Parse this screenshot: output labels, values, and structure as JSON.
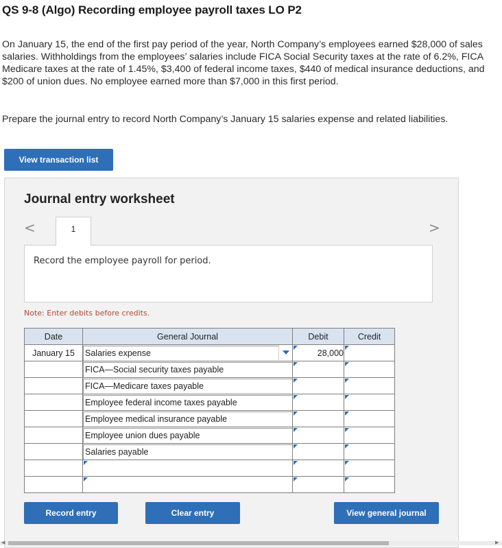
{
  "question": {
    "title": "QS 9-8 (Algo) Recording employee payroll taxes LO P2",
    "problem": "On January 15, the end of the first pay period of the year, North Company’s employees earned $28,000 of sales salaries. Withholdings from the employees’ salaries include FICA Social Security taxes at the rate of 6.2%, FICA Medicare taxes at the rate of 1.45%, $3,400 of federal income taxes, $440 of medical insurance deductions, and $200 of union dues. No employee earned more than $7,000 in this first period.",
    "instruction": "Prepare the journal entry to record North Company’s January 15 salaries expense and related liabilities."
  },
  "buttons": {
    "view_transactions": "View transaction list",
    "record_entry": "Record entry",
    "clear_entry": "Clear entry",
    "view_journal": "View general journal"
  },
  "worksheet": {
    "title": "Journal entry worksheet",
    "tab_number": "1",
    "nav_prev": "<",
    "nav_next": ">",
    "entry_description": "Record the employee payroll for period.",
    "note": "Note: Enter debits before credits."
  },
  "journal": {
    "headers": {
      "date": "Date",
      "account": "General Journal",
      "debit": "Debit",
      "credit": "Credit"
    },
    "rows": [
      {
        "date": "January 15",
        "account": "Salaries expense",
        "debit": "28,000",
        "credit": ""
      },
      {
        "date": "",
        "account": "FICA—Social security taxes payable",
        "debit": "",
        "credit": ""
      },
      {
        "date": "",
        "account": "FICA—Medicare taxes payable",
        "debit": "",
        "credit": ""
      },
      {
        "date": "",
        "account": "Employee federal income taxes payable",
        "debit": "",
        "credit": ""
      },
      {
        "date": "",
        "account": "Employee medical insurance payable",
        "debit": "",
        "credit": ""
      },
      {
        "date": "",
        "account": "Employee union dues payable",
        "debit": "",
        "credit": ""
      },
      {
        "date": "",
        "account": "Salaries payable",
        "debit": "",
        "credit": ""
      },
      {
        "date": "",
        "account": "",
        "debit": "",
        "credit": ""
      },
      {
        "date": "",
        "account": "",
        "debit": "",
        "credit": ""
      }
    ]
  },
  "colors": {
    "accent": "#2e6fb7",
    "header_bg": "#d9e3f0",
    "note": "#b04a32"
  }
}
